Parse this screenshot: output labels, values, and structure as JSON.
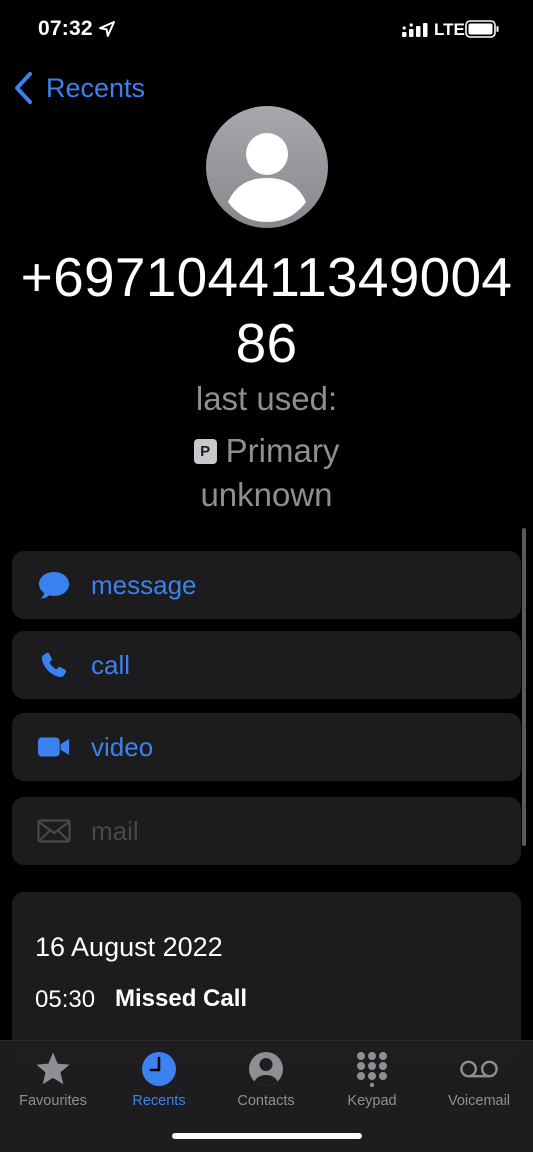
{
  "status_bar": {
    "time": "07:32",
    "network": "LTE",
    "icons": [
      "location-arrow-icon",
      "signal-icon",
      "battery-icon"
    ]
  },
  "nav": {
    "back_label": "Recents",
    "back_icon": "chevron-left-icon"
  },
  "contact": {
    "avatar_icon": "person-silhouette-icon",
    "phone_number": "+69710441134900486",
    "last_used_label": "last used:",
    "line_badge": "P",
    "line_name": "Primary",
    "status": "unknown"
  },
  "actions": [
    {
      "label": "message",
      "icon": "speech-bubble-icon",
      "enabled": true
    },
    {
      "label": "call",
      "icon": "phone-icon",
      "enabled": true
    },
    {
      "label": "video",
      "icon": "video-camera-icon",
      "enabled": true
    },
    {
      "label": "mail",
      "icon": "envelope-icon",
      "enabled": false
    }
  ],
  "history": {
    "date": "16 August 2022",
    "time": "05:30",
    "type": "Missed Call"
  },
  "tabs": [
    {
      "label": "Favourites",
      "icon": "star-icon",
      "active": false
    },
    {
      "label": "Recents",
      "icon": "clock-icon",
      "active": true
    },
    {
      "label": "Contacts",
      "icon": "person-circle-icon",
      "active": false
    },
    {
      "label": "Keypad",
      "icon": "keypad-icon",
      "active": false
    },
    {
      "label": "Voicemail",
      "icon": "voicemail-icon",
      "active": false
    }
  ],
  "colors": {
    "accent": "#3b82f0",
    "background": "#000000",
    "card": "#1c1c1e",
    "secondary_text": "#8e8e93"
  }
}
